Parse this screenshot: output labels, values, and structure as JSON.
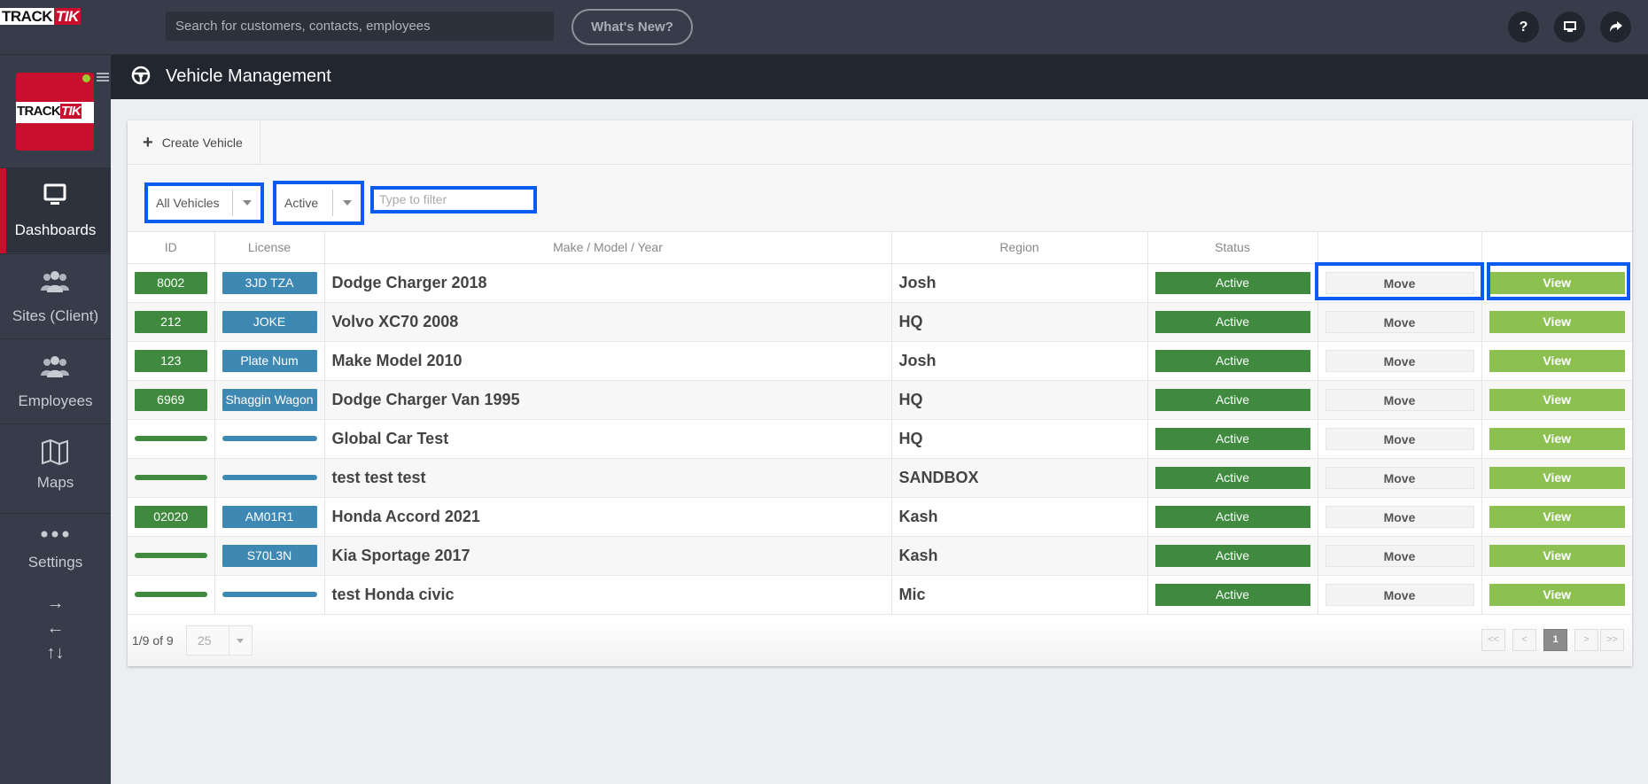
{
  "app": {
    "brand_track": "TRACK",
    "brand_tik": "TIK",
    "search_placeholder": "Search for customers, contacts, employees",
    "whats_new": "What's New?",
    "help_icon": "?"
  },
  "sidebar": {
    "logo_track": "TRACK",
    "logo_tik": "TIK",
    "items": [
      {
        "label": "Dashboards",
        "icon": "monitor-icon",
        "active": true
      },
      {
        "label": "Sites (Client)",
        "icon": "people-icon",
        "active": false
      },
      {
        "label": "Employees",
        "icon": "people-icon",
        "active": false
      },
      {
        "label": "Maps",
        "icon": "map-icon",
        "active": false
      },
      {
        "label": "Settings",
        "icon": "dots-icon",
        "active": false
      }
    ],
    "arrows": [
      "→",
      "←",
      "↑↓"
    ]
  },
  "page": {
    "title": "Vehicle Management",
    "create_label": "Create Vehicle",
    "filter_vehicles": "All Vehicles",
    "filter_status": "Active",
    "filter_placeholder": "Type to filter"
  },
  "table": {
    "columns": [
      "ID",
      "License",
      "Make / Model / Year",
      "Region",
      "Status",
      "",
      ""
    ],
    "rows": [
      {
        "id": "8002",
        "license": "3JD TZA",
        "make": "Dodge Charger 2018",
        "region": "Josh",
        "status": "Active",
        "move": "Move",
        "view": "View"
      },
      {
        "id": "212",
        "license": "JOKE",
        "make": "Volvo XC70 2008",
        "region": "HQ",
        "status": "Active",
        "move": "Move",
        "view": "View"
      },
      {
        "id": "123",
        "license": "Plate Num",
        "make": "Make Model 2010",
        "region": "Josh",
        "status": "Active",
        "move": "Move",
        "view": "View"
      },
      {
        "id": "6969",
        "license": "Shaggin Wagon",
        "make": "Dodge Charger Van 1995",
        "region": "HQ",
        "status": "Active",
        "move": "Move",
        "view": "View"
      },
      {
        "id": "",
        "license": "",
        "make": "Global Car Test",
        "region": "HQ",
        "status": "Active",
        "move": "Move",
        "view": "View"
      },
      {
        "id": "",
        "license": "",
        "make": "test test test",
        "region": "SANDBOX",
        "status": "Active",
        "move": "Move",
        "view": "View"
      },
      {
        "id": "02020",
        "license": "AM01R1",
        "make": "Honda Accord 2021",
        "region": "Kash",
        "status": "Active",
        "move": "Move",
        "view": "View"
      },
      {
        "id": "",
        "license": "S70L3N",
        "make": "Kia Sportage 2017",
        "region": "Kash",
        "status": "Active",
        "move": "Move",
        "view": "View"
      },
      {
        "id": "",
        "license": "",
        "make": "test Honda civic",
        "region": "Mic",
        "status": "Active",
        "move": "Move",
        "view": "View"
      }
    ]
  },
  "footer": {
    "count": "1/9 of 9",
    "page_size": "25",
    "pager": [
      "<<",
      "<",
      "1",
      ">",
      ">>"
    ],
    "current_page": "1"
  },
  "colors": {
    "accent_red": "#c8102e",
    "id_green": "#3f8a3f",
    "license_blue": "#3e88b4",
    "view_green": "#8cc152",
    "highlight_blue": "#0a5cf0"
  }
}
